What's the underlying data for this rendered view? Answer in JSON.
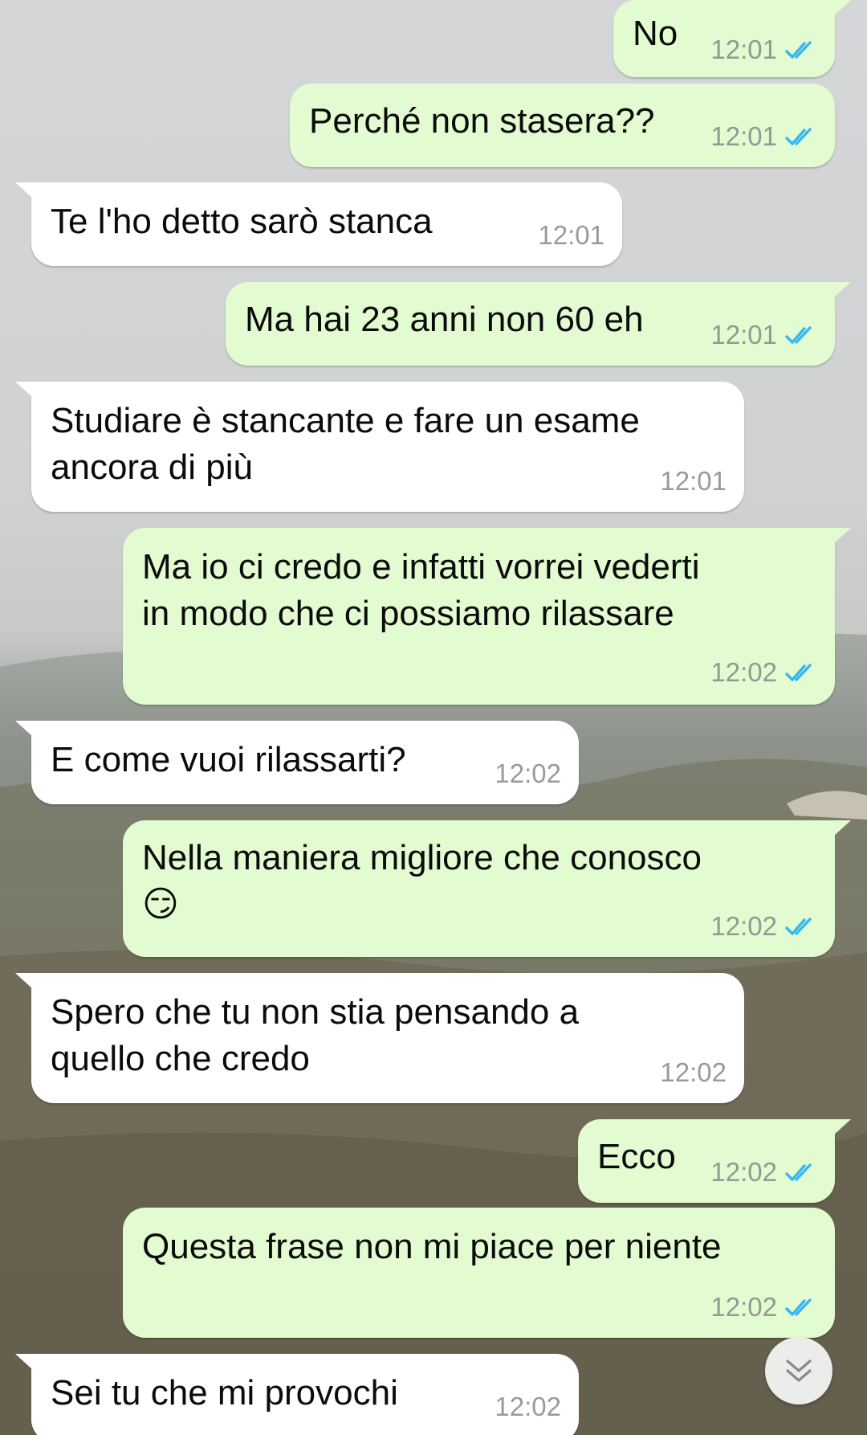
{
  "conversation": {
    "messages": [
      {
        "direction": "out",
        "text": "No",
        "time": "12:01",
        "status": "read"
      },
      {
        "direction": "out",
        "text": "Perché non stasera??",
        "time": "12:01",
        "status": "read"
      },
      {
        "direction": "in",
        "text": "Te l'ho detto sarò stanca",
        "time": "12:01"
      },
      {
        "direction": "out",
        "text": "Ma hai 23 anni non 60 eh",
        "time": "12:01",
        "status": "read"
      },
      {
        "direction": "in",
        "text": "Studiare è stancante e fare un esame\nancora di più",
        "time": "12:01"
      },
      {
        "direction": "out",
        "text": "Ma io ci credo e infatti vorrei vederti\nin modo che ci possiamo rilassare",
        "time": "12:02",
        "status": "read"
      },
      {
        "direction": "in",
        "text": "E come vuoi rilassarti?",
        "time": "12:02"
      },
      {
        "direction": "out",
        "text": "Nella maniera migliore che conosco\n😏",
        "time": "12:02",
        "status": "read"
      },
      {
        "direction": "in",
        "text": "Spero che tu non stia pensando a\nquello che credo",
        "time": "12:02"
      },
      {
        "direction": "out",
        "text": "Ecco",
        "time": "12:02",
        "status": "read"
      },
      {
        "direction": "out",
        "text": "Questa frase non mi piace per niente",
        "time": "12:02",
        "status": "read"
      },
      {
        "direction": "in",
        "text": "Sei tu che mi provochi",
        "time": "12:02"
      }
    ]
  },
  "scroll_button": {
    "icon": "double-chevron-down-icon"
  },
  "colors": {
    "outgoing_bubble": "#e3fbd0",
    "incoming_bubble": "#ffffff",
    "read_ticks": "#34b7f1",
    "timestamp": "#8f9a92"
  }
}
